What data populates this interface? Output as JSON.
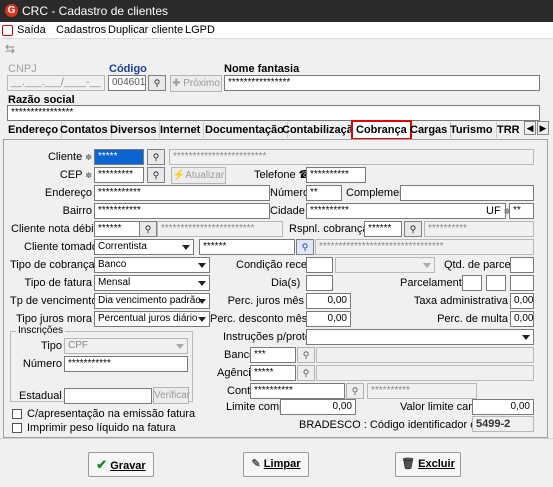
{
  "window": {
    "title": "CRC - Cadastro de clientes"
  },
  "menu": [
    "Saída",
    "Cadastros",
    "Duplicar cliente",
    "LGPD"
  ],
  "header": {
    "cnpj_label": "CNPJ",
    "cnpj_mask": "__.___.___/____-__",
    "codigo_label": "Código",
    "codigo_value": "004601",
    "proximo_label": "Próximo",
    "nome_fantasia_label": "Nome fantasia",
    "nome_fantasia_value": "****************",
    "razao_social_label": "Razão social",
    "razao_social_value": "****************"
  },
  "tabs": [
    "Endereço",
    "Contatos",
    "Diversos",
    "Internet",
    "Documentação",
    "Contabilização",
    "Cobrança",
    "Cargas",
    "Turismo",
    "TRR"
  ],
  "active_tab": "Cobrança",
  "form": {
    "cliente_label": "Cliente",
    "cliente_code": "*****",
    "cliente_name": "************************",
    "cep_label": "CEP",
    "cep_value": "*********",
    "atualizar_label": "Atualizar",
    "telefone_label": "Telefone",
    "telefone_value": "**********",
    "endereco_label": "Endereço",
    "endereco_value": "***********",
    "numero_label": "Número",
    "numero_value": "**",
    "complemento_label": "Complemento",
    "bairro_label": "Bairro",
    "bairro_value": "***********",
    "cidade_label": "Cidade",
    "cidade_value": "**********",
    "uf_label": "UF",
    "uf_value": "**",
    "cliente_nota_debito_label": "Cliente nota débito",
    "cliente_nota_debito_value": "******",
    "cliente_nota_debito_name": "************************",
    "rspnl_cobranca_label": "Rspnl. cobrança",
    "rspnl_cobranca_value": "******",
    "rspnl_cobranca_name": "**********",
    "cliente_tomador_label": "Cliente tomador",
    "cliente_tomador_type": "Correntista",
    "cliente_tomador_code": "******",
    "cliente_tomador_name": "********************************",
    "tipo_cobranca_label": "Tipo de cobrança",
    "tipo_cobranca_value": "Banco",
    "condicao_recebto_label": "Condição recebto",
    "qtd_parcelas_label": "Qtd. de parcelas",
    "tipo_fatura_label": "Tipo de fatura",
    "tipo_fatura_value": "Mensal",
    "dias_label": "Dia(s)",
    "parcelamento_label": "Parcelamento",
    "tp_vencimento_label": "Tp de vencimento",
    "tp_vencimento_value": "Dia vencimento padrão",
    "perc_juros_label": "Perc. juros mês",
    "perc_juros_value": "0,00",
    "taxa_adm_label": "Taxa administrativa",
    "taxa_adm_value": "0,00",
    "tipo_juros_mora_label": "Tipo juros mora",
    "tipo_juros_mora_value": "Percentual juros diário",
    "perc_desconto_label": "Perc. desconto mês",
    "perc_desconto_value": "0,00",
    "perc_multa_label": "Perc. de multa",
    "perc_multa_value": "0,00",
    "instrucoes_label": "Instruções p/protesto",
    "banco_label": "Banco",
    "banco_value": "***",
    "agencia_label": "Agência",
    "agencia_value": "*****",
    "conta_label": "Conta",
    "conta_value": "**********",
    "conta_name": "**********",
    "limite_compra_label": "Limite compra",
    "limite_compra_value": "0,00",
    "valor_limite_cargas_label": "Valor limite cargas",
    "valor_limite_cargas_value": "0,00",
    "bradesco_label": "BRADESCO : Código identificador do cliente",
    "bradesco_value": "5499-2"
  },
  "inscricoes": {
    "group_label": "Inscrições",
    "tipo_label": "Tipo",
    "tipo_value": "CPF",
    "numero_label": "Número",
    "numero_value": "***********",
    "estadual_label": "Estadual",
    "verificar_label": "Verificar"
  },
  "checkboxes": {
    "apresentacao": "C/apresentação na emissão fatura",
    "peso_liquido": "Imprimir peso líquido na fatura"
  },
  "buttons": {
    "gravar": "Gravar",
    "limpar": "Limpar",
    "excluir": "Excluir"
  }
}
